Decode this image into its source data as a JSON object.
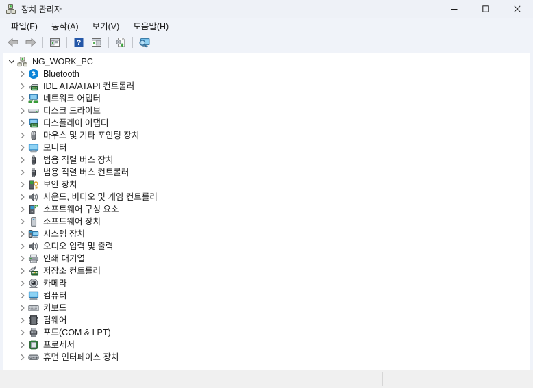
{
  "window": {
    "title": "장치 관리자",
    "icon": "device-manager-icon",
    "controls": {
      "minimize": "–",
      "maximize": "□",
      "close": "✕"
    }
  },
  "menubar": {
    "items": [
      {
        "label": "파일(F)",
        "name": "menu-file"
      },
      {
        "label": "동작(A)",
        "name": "menu-action"
      },
      {
        "label": "보기(V)",
        "name": "menu-view"
      },
      {
        "label": "도움말(H)",
        "name": "menu-help"
      }
    ]
  },
  "toolbar": {
    "buttons": [
      {
        "icon": "back-arrow-icon",
        "tip": "뒤로"
      },
      {
        "icon": "forward-arrow-icon",
        "tip": "앞으로"
      },
      {
        "icon": "show-hide-console-tree-icon",
        "tip": "콘솔 트리 표시/숨기기"
      },
      {
        "icon": "help-icon",
        "tip": "도움말"
      },
      {
        "icon": "properties-icon",
        "tip": "속성"
      },
      {
        "icon": "update-driver-icon",
        "tip": "드라이버 업데이트"
      },
      {
        "icon": "scan-hardware-changes-icon",
        "tip": "하드웨어 변경 사항 검색"
      }
    ]
  },
  "tree": {
    "root": {
      "label": "NG_WORK_PC",
      "icon": "computer-root-icon",
      "expanded": true,
      "chevron": "chevron-down-icon"
    },
    "items": [
      {
        "label": "Bluetooth",
        "icon": "bluetooth-icon"
      },
      {
        "label": "IDE ATA/ATAPI 컨트롤러",
        "icon": "ide-controller-icon"
      },
      {
        "label": "네트워크 어댑터",
        "icon": "network-adapter-icon"
      },
      {
        "label": "디스크 드라이브",
        "icon": "disk-drive-icon"
      },
      {
        "label": "디스플레이 어댑터",
        "icon": "display-adapter-icon"
      },
      {
        "label": "마우스 및 기타 포인팅 장치",
        "icon": "mouse-icon"
      },
      {
        "label": "모니터",
        "icon": "monitor-icon"
      },
      {
        "label": "범용 직렬 버스 장치",
        "icon": "usb-device-icon"
      },
      {
        "label": "범용 직렬 버스 컨트롤러",
        "icon": "usb-controller-icon"
      },
      {
        "label": "보안 장치",
        "icon": "security-device-icon"
      },
      {
        "label": "사운드, 비디오 및 게임 컨트롤러",
        "icon": "sound-icon"
      },
      {
        "label": "소프트웨어 구성 요소",
        "icon": "software-component-icon"
      },
      {
        "label": "소프트웨어 장치",
        "icon": "software-device-icon"
      },
      {
        "label": "시스템 장치",
        "icon": "system-device-icon"
      },
      {
        "label": "오디오 입력 및 출력",
        "icon": "audio-io-icon"
      },
      {
        "label": "인쇄 대기열",
        "icon": "print-queue-icon"
      },
      {
        "label": "저장소 컨트롤러",
        "icon": "storage-controller-icon"
      },
      {
        "label": "카메라",
        "icon": "camera-icon"
      },
      {
        "label": "컴퓨터",
        "icon": "computer-icon"
      },
      {
        "label": "키보드",
        "icon": "keyboard-icon"
      },
      {
        "label": "펌웨어",
        "icon": "firmware-icon"
      },
      {
        "label": "포트(COM & LPT)",
        "icon": "ports-icon"
      },
      {
        "label": "프로세서",
        "icon": "processor-icon"
      },
      {
        "label": "휴먼 인터페이스 장치",
        "icon": "hid-icon"
      }
    ],
    "child_chevron": "chevron-right-icon"
  },
  "statusbar": {
    "pane1": "",
    "pane2": "",
    "pane3": ""
  },
  "colors": {
    "titlebar_bg": "#eef1f7",
    "chrome_bg": "#f0f3f9",
    "content_bg": "#ffffff",
    "text": "#1a1a1a",
    "accent_blue": "#0a84d8",
    "status_bg": "#f0f0f0"
  }
}
